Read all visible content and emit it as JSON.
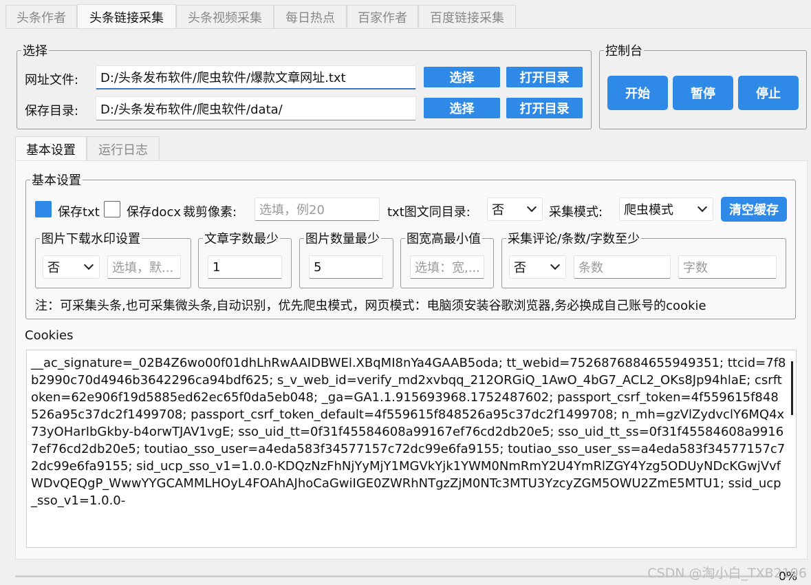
{
  "top_tabs": [
    "头条作者",
    "头条链接采集",
    "头条视频采集",
    "每日热点",
    "百家作者",
    "百度链接采集"
  ],
  "select_group": {
    "legend": "选择",
    "url_file_label": "网址文件:",
    "url_file_value": "D:/头条发布软件/爬虫软件/爆款文章网址.txt",
    "save_dir_label": "保存目录:",
    "save_dir_value": "D:/头条发布软件/爬虫软件/data/",
    "choose_label": "选择",
    "open_dir_label": "打开目录"
  },
  "console": {
    "legend": "控制台",
    "start": "开始",
    "pause": "暂停",
    "stop": "停止"
  },
  "sub_tabs": [
    "基本设置",
    "运行日志"
  ],
  "basic": {
    "legend": "基本设置",
    "save_txt": "保存txt",
    "save_txt_checked": true,
    "save_docx": "保存docx",
    "save_docx_checked": false,
    "crop_label": "裁剪像素:",
    "crop_placeholder": "选填，例20",
    "txt_same_dir_label": "txt图文同目录:",
    "txt_same_dir_value": "否",
    "mode_label": "采集模式:",
    "mode_value": "爬虫模式",
    "clear_cache": "清空缓存",
    "watermark_legend": "图片下载水印设置",
    "watermark_value": "否",
    "watermark_placeholder": "选填，默...",
    "min_words_legend": "文章字数最少",
    "min_words_value": "1",
    "min_images_legend": "图片数量最少",
    "min_images_value": "5",
    "min_size_legend": "图宽高最小值",
    "min_size_placeholder": "选填：宽,...",
    "comments_legend": "采集评论/条数/字数至少",
    "comments_value": "否",
    "comments_count_placeholder": "条数",
    "comments_chars_placeholder": "字数",
    "note": "注：可采集头条,也可采集微头条,自动识别，优先爬虫模式，网页模式：电脑须安装谷歌浏览器,务必换成自己账号的cookie"
  },
  "cookies": {
    "label": "Cookies",
    "text": "__ac_signature=_02B4Z6wo00f01dhLhRwAAIDBWEl.XBqMI8nYa4GAAB5oda; tt_webid=7526876884655949351; ttcid=7f8b2990c70d4946b3642296ca94bdf625; s_v_web_id=verify_md2xvbqq_212ORGiQ_1AwO_4bG7_ACL2_OKs8Jp94hlaE; csrftoken=62e906f19d5885ed62ec65f0da5eb048; _ga=GA1.1.915693968.1752487602; passport_csrf_token=4f559615f848526a95c37dc2f1499708; passport_csrf_token_default=4f559615f848526a95c37dc2f1499708; n_mh=gzVlZydvclY6MQ4x73yOHarIbGkby-b4orwTJAV1vgE; sso_uid_tt=0f31f45584608a99167ef76cd2db20e5; sso_uid_tt_ss=0f31f45584608a99167ef76cd2db20e5; toutiao_sso_user=a4eda583f34577157c72dc99e6fa9155; toutiao_sso_user_ss=a4eda583f34577157c72dc99e6fa9155; sid_ucp_sso_v1=1.0.0-KDQzNzFhNjYyMjY1MGVkYjk1YWM0NmRmY2U4YmRlZGY4Yzg5ODUyNDcKGwjVvfWDvQEQgP_WwwYYGCAMMLHOyL4FOAhAJhoCaGwiIGE0ZWRhNTgzZjM0NTc3MTU3YzcyZGM5OWU2ZmE5MTU1; ssid_ucp_sso_v1=1.0.0-"
  },
  "progress": {
    "percent": "0%",
    "value": 0
  },
  "watermark_text": "CSDN @淘小白_TXB2196"
}
